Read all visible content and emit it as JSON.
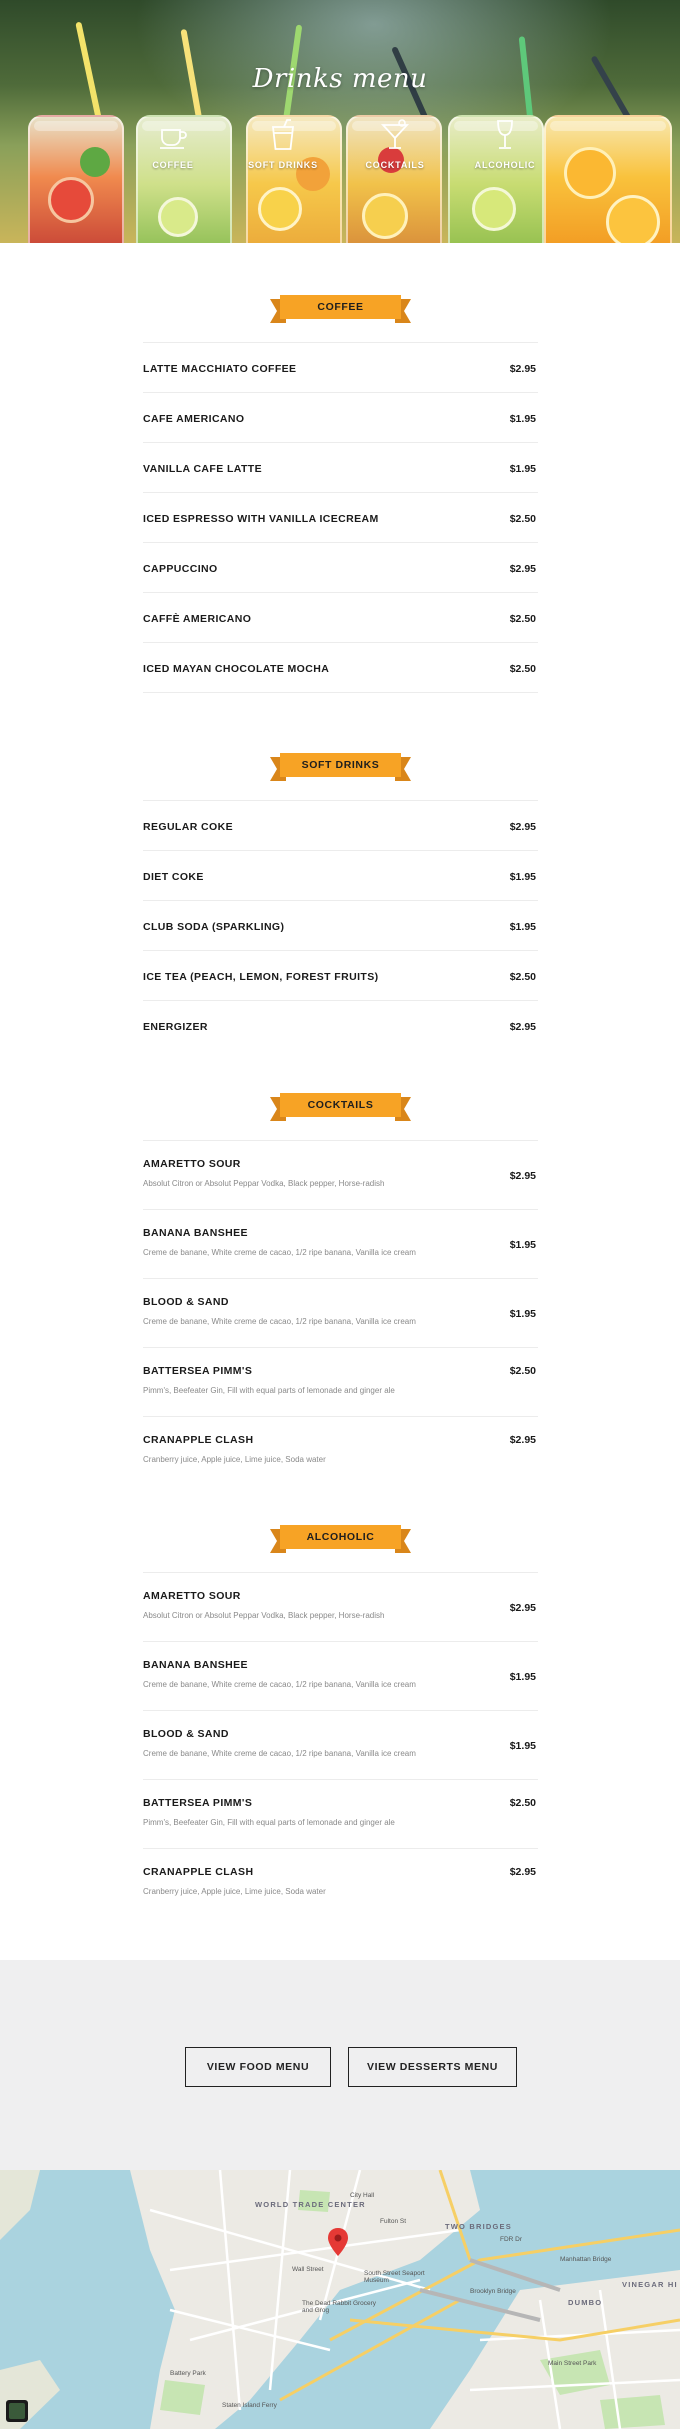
{
  "hero": {
    "title": "Drinks menu",
    "nav": [
      {
        "label": "COFFEE",
        "icon": "coffee-cup-icon"
      },
      {
        "label": "SOFT DRINKS",
        "icon": "soft-drink-cup-icon"
      },
      {
        "label": "COCKTAILS",
        "icon": "cocktail-glass-icon"
      },
      {
        "label": "ALCOHOLIC",
        "icon": "wine-glass-icon"
      }
    ]
  },
  "colors": {
    "accent": "#f7a325",
    "accent_dark": "#d9861a",
    "band": "#efeff0"
  },
  "sections": [
    {
      "title": "COFFEE",
      "items": [
        {
          "name": "LATTE MACCHIATO COFFEE",
          "price": "$2.95"
        },
        {
          "name": "CAFE AMERICANO",
          "price": "$1.95"
        },
        {
          "name": "VANILLA CAFE LATTE",
          "price": "$1.95"
        },
        {
          "name": "ICED ESPRESSO WITH VANILLA ICECREAM",
          "price": "$2.50"
        },
        {
          "name": "CAPPUCCINO",
          "price": "$2.95"
        },
        {
          "name": "CAFFÈ AMERICANO",
          "price": "$2.50"
        },
        {
          "name": "ICED MAYAN CHOCOLATE MOCHA",
          "price": "$2.50"
        }
      ]
    },
    {
      "title": "SOFT DRINKS",
      "items": [
        {
          "name": "REGULAR COKE",
          "price": "$2.95"
        },
        {
          "name": "DIET COKE",
          "price": "$1.95"
        },
        {
          "name": "CLUB SODA (SPARKLING)",
          "price": "$1.95"
        },
        {
          "name": "ICE TEA (PEACH, LEMON, FOREST FRUITS)",
          "price": "$2.50"
        },
        {
          "name": "ENERGIZER",
          "price": "$2.95"
        }
      ]
    },
    {
      "title": "COCKTAILS",
      "items": [
        {
          "name": "AMARETTO SOUR",
          "desc": "Absolut Citron or Absolut Peppar Vodka, Black pepper, Horse-radish",
          "price": "$2.95"
        },
        {
          "name": "BANANA BANSHEE",
          "desc": "Creme de banane, White creme de cacao, 1/2 ripe banana, Vanilla ice cream",
          "price": "$1.95"
        },
        {
          "name": "BLOOD & SAND",
          "desc": "Creme de banane, White creme de cacao, 1/2 ripe banana, Vanilla ice cream",
          "price": "$1.95"
        },
        {
          "name": "BATTERSEA PIMM'S",
          "desc": "Pimm's, Beefeater Gin, Fill with equal parts of lemonade and ginger ale",
          "price": "$2.50"
        },
        {
          "name": "CRANAPPLE CLASH",
          "desc": "Cranberry juice, Apple juice, Lime juice, Soda water",
          "price": "$2.95"
        }
      ]
    },
    {
      "title": "ALCOHOLIC",
      "items": [
        {
          "name": "AMARETTO SOUR",
          "desc": "Absolut Citron or Absolut Peppar Vodka, Black pepper, Horse-radish",
          "price": "$2.95"
        },
        {
          "name": "BANANA BANSHEE",
          "desc": "Creme de banane, White creme de cacao, 1/2 ripe banana, Vanilla ice cream",
          "price": "$1.95"
        },
        {
          "name": "BLOOD & SAND",
          "desc": "Creme de banane, White creme de cacao, 1/2 ripe banana, Vanilla ice cream",
          "price": "$1.95"
        },
        {
          "name": "BATTERSEA PIMM'S",
          "desc": "Pimm's, Beefeater Gin, Fill with equal parts of lemonade and ginger ale",
          "price": "$2.50"
        },
        {
          "name": "CRANAPPLE CLASH",
          "desc": "Cranberry juice, Apple juice, Lime juice, Soda water",
          "price": "$2.95"
        }
      ]
    }
  ],
  "buttons": {
    "food": "VIEW FOOD MENU",
    "desserts": "VIEW DESSERTS MENU"
  },
  "map": {
    "labels": [
      "WORLD TRADE CENTER",
      "TWO BRIDGES",
      "DUMBO",
      "VINEGAR HI",
      "City Hall",
      "Fulton St",
      "Wall Street",
      "The Dead Rabbit Grocery and Grog",
      "South Street Seaport Museum",
      "Brooklyn Bridge",
      "Battery Park",
      "Staten Island Ferry",
      "FDR Dr",
      "Manhattan Bridge",
      "Main Street Park"
    ]
  }
}
